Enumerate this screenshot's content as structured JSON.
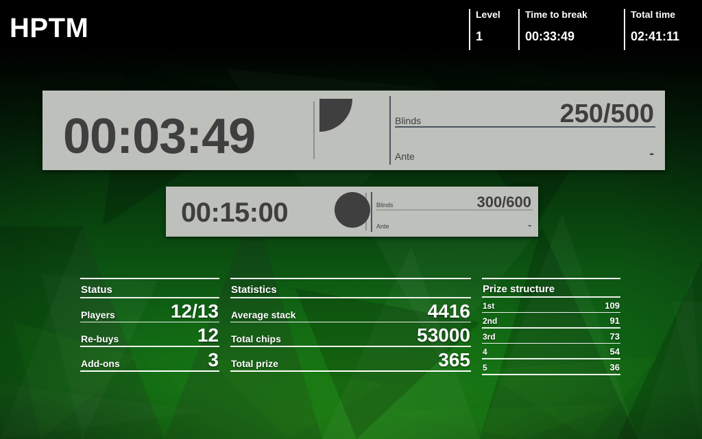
{
  "app": {
    "logo": "HPTM",
    "accent_green": "#0f6414",
    "panel_bg": "#bdc0bb",
    "panel_text": "#3f3f3f",
    "rule_color": "#4a5560"
  },
  "header": {
    "level": {
      "label": "Level",
      "value": "1"
    },
    "break": {
      "label": "Time to break",
      "value": "00:33:49"
    },
    "total": {
      "label": "Total time",
      "value": "02:41:11"
    }
  },
  "current_level": {
    "clock": "00:03:49",
    "progress_icon": "pie-quarter-icon",
    "progress_fraction": 0.25,
    "blinds": {
      "label": "Blinds",
      "value": "250/500"
    },
    "ante": {
      "label": "Ante",
      "value": "-"
    }
  },
  "next_level": {
    "clock": "00:15:00",
    "progress_icon": "pie-full-icon",
    "progress_fraction": 1,
    "blinds": {
      "label": "Blinds",
      "value": "300/600"
    },
    "ante": {
      "label": "Ante",
      "value": "-"
    }
  },
  "status_table": {
    "title": "Status",
    "rows": [
      {
        "label": "Players",
        "value": "12/13"
      },
      {
        "label": "Re-buys",
        "value": "12"
      },
      {
        "label": "Add-ons",
        "value": "3"
      }
    ]
  },
  "statistics_table": {
    "title": "Statistics",
    "rows": [
      {
        "label": "Average stack",
        "value": "4416"
      },
      {
        "label": "Total chips",
        "value": "53000"
      },
      {
        "label": "Total prize",
        "value": "365"
      }
    ]
  },
  "prize_table": {
    "title": "Prize structure",
    "rows": [
      {
        "label": "1st",
        "value": "109"
      },
      {
        "label": "2nd",
        "value": "91"
      },
      {
        "label": "3rd",
        "value": "73"
      },
      {
        "label": "4",
        "value": "54"
      },
      {
        "label": "5",
        "value": "36"
      }
    ]
  }
}
